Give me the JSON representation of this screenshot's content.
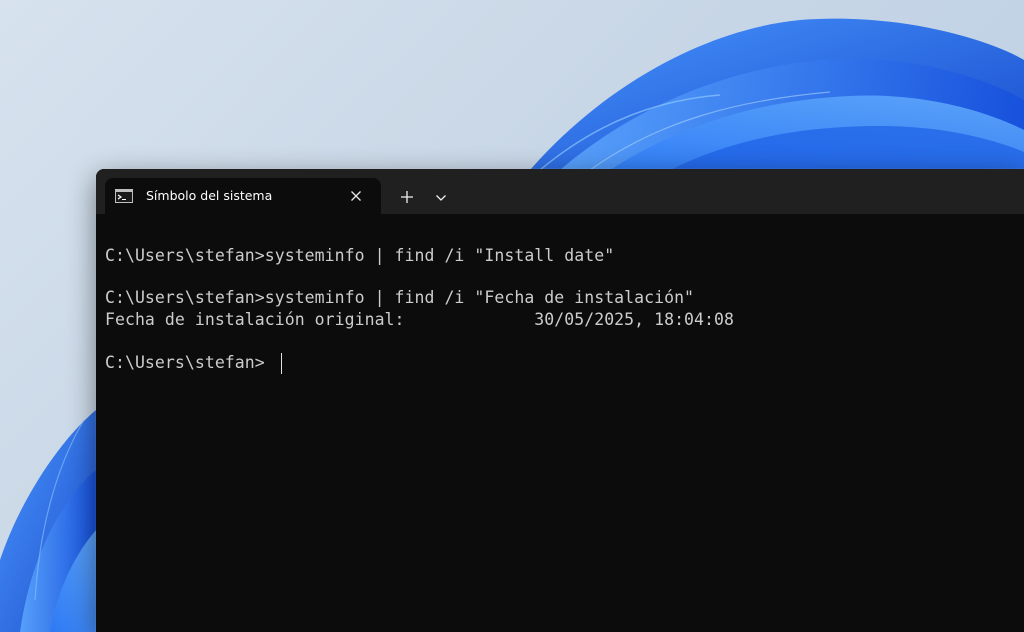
{
  "window": {
    "tab_title": "Símbolo del sistema",
    "tab_icon": "command-prompt-icon",
    "close_icon": "close-icon",
    "new_tab_icon": "plus-icon",
    "dropdown_icon": "chevron-down-icon"
  },
  "console": {
    "lines": [
      "C:\\Users\\stefan>systeminfo | find /i \"Install date\"",
      "C:\\Users\\stefan>systeminfo | find /i \"Fecha de instalación\"",
      "Fecha de instalación original:             30/05/2025, 18:04:08",
      "C:\\Users\\stefan>"
    ]
  },
  "colors": {
    "terminal_background": "#0c0c0c",
    "tab_strip_background": "#202020",
    "console_text": "#cccccc",
    "wallpaper_accent": "#1a63e8"
  }
}
